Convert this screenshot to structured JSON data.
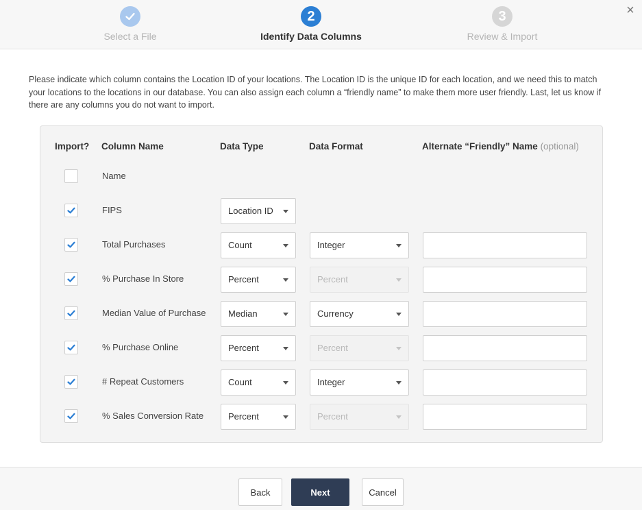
{
  "steps": [
    {
      "number": "",
      "label": "Select a File",
      "state": "done"
    },
    {
      "number": "2",
      "label": "Identify Data Columns",
      "state": "active"
    },
    {
      "number": "3",
      "label": "Review & Import",
      "state": "pending"
    }
  ],
  "close_icon": "×",
  "intro": "Please indicate which column contains the Location ID of your locations. The Location ID is the unique ID for each location, and we need this to match your locations to the locations in our database. You can also assign each column a “friendly name” to make them more user friendly. Last, let us know if there are any columns you do not want to import.",
  "table": {
    "headers": {
      "import": "Import?",
      "column_name": "Column Name",
      "data_type": "Data Type",
      "data_format": "Data Format",
      "friendly": "Alternate “Friendly” Name",
      "friendly_optional": "(optional)"
    },
    "rows": [
      {
        "checked": false,
        "name": "Name",
        "data_type": "",
        "data_format": "",
        "format_disabled": false,
        "friendly": ""
      },
      {
        "checked": true,
        "name": "FIPS",
        "data_type": "Location ID",
        "data_format": "",
        "format_disabled": false,
        "friendly": ""
      },
      {
        "checked": true,
        "name": "Total Purchases",
        "data_type": "Count",
        "data_format": "Integer",
        "format_disabled": false,
        "friendly": ""
      },
      {
        "checked": true,
        "name": "% Purchase In Store",
        "data_type": "Percent",
        "data_format": "Percent",
        "format_disabled": true,
        "friendly": ""
      },
      {
        "checked": true,
        "name": "Median Value of Purchase",
        "data_type": "Median",
        "data_format": "Currency",
        "format_disabled": false,
        "friendly": ""
      },
      {
        "checked": true,
        "name": "% Purchase Online",
        "data_type": "Percent",
        "data_format": "Percent",
        "format_disabled": true,
        "friendly": ""
      },
      {
        "checked": true,
        "name": "# Repeat Customers",
        "data_type": "Count",
        "data_format": "Integer",
        "format_disabled": false,
        "friendly": ""
      },
      {
        "checked": true,
        "name": "% Sales Conversion Rate",
        "data_type": "Percent",
        "data_format": "Percent",
        "format_disabled": true,
        "friendly": ""
      }
    ]
  },
  "footer": {
    "back_label": "Back",
    "next_label": "Next",
    "cancel_label": "Cancel"
  },
  "colors": {
    "accent": "#2c7fd4",
    "step_done": "#a9c8ee",
    "step_pending": "#d6d6d6",
    "primary_button": "#2f3d55",
    "checkmark": "#2c7fd4"
  }
}
